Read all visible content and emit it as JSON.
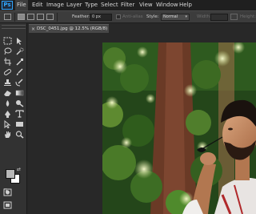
{
  "app": {
    "logo_text": "Ps",
    "menu": [
      "File",
      "Edit",
      "Image",
      "Layer",
      "Type",
      "Select",
      "Filter",
      "View",
      "Window",
      "Help"
    ],
    "active_menu": "File"
  },
  "options_bar": {
    "feather_label": "Feather:",
    "feather_value": "0 px",
    "antialias_label": "Anti-alias",
    "style_label": "Style:",
    "style_value": "Normal",
    "width_label": "Width:",
    "height_label": "Height:"
  },
  "document": {
    "tab_title": "DSC_0451.jpg @ 12.5% (RGB/8)",
    "close_glyph": "×"
  },
  "colors": {
    "foreground": "#b8b8b8",
    "background": "#ffffff",
    "accent": "#31a8ff"
  },
  "tools": [
    "marquee-icon",
    "move-icon",
    "lasso-icon",
    "quick-selection-icon",
    "crop-icon",
    "eyedropper-icon",
    "healing-icon",
    "brush-icon",
    "clone-stamp-icon",
    "history-brush-icon",
    "eraser-icon",
    "gradient-icon",
    "blur-icon",
    "dodge-icon",
    "pen-icon",
    "type-icon",
    "path-selection-icon",
    "rectangle-icon",
    "hand-icon",
    "zoom-icon"
  ]
}
